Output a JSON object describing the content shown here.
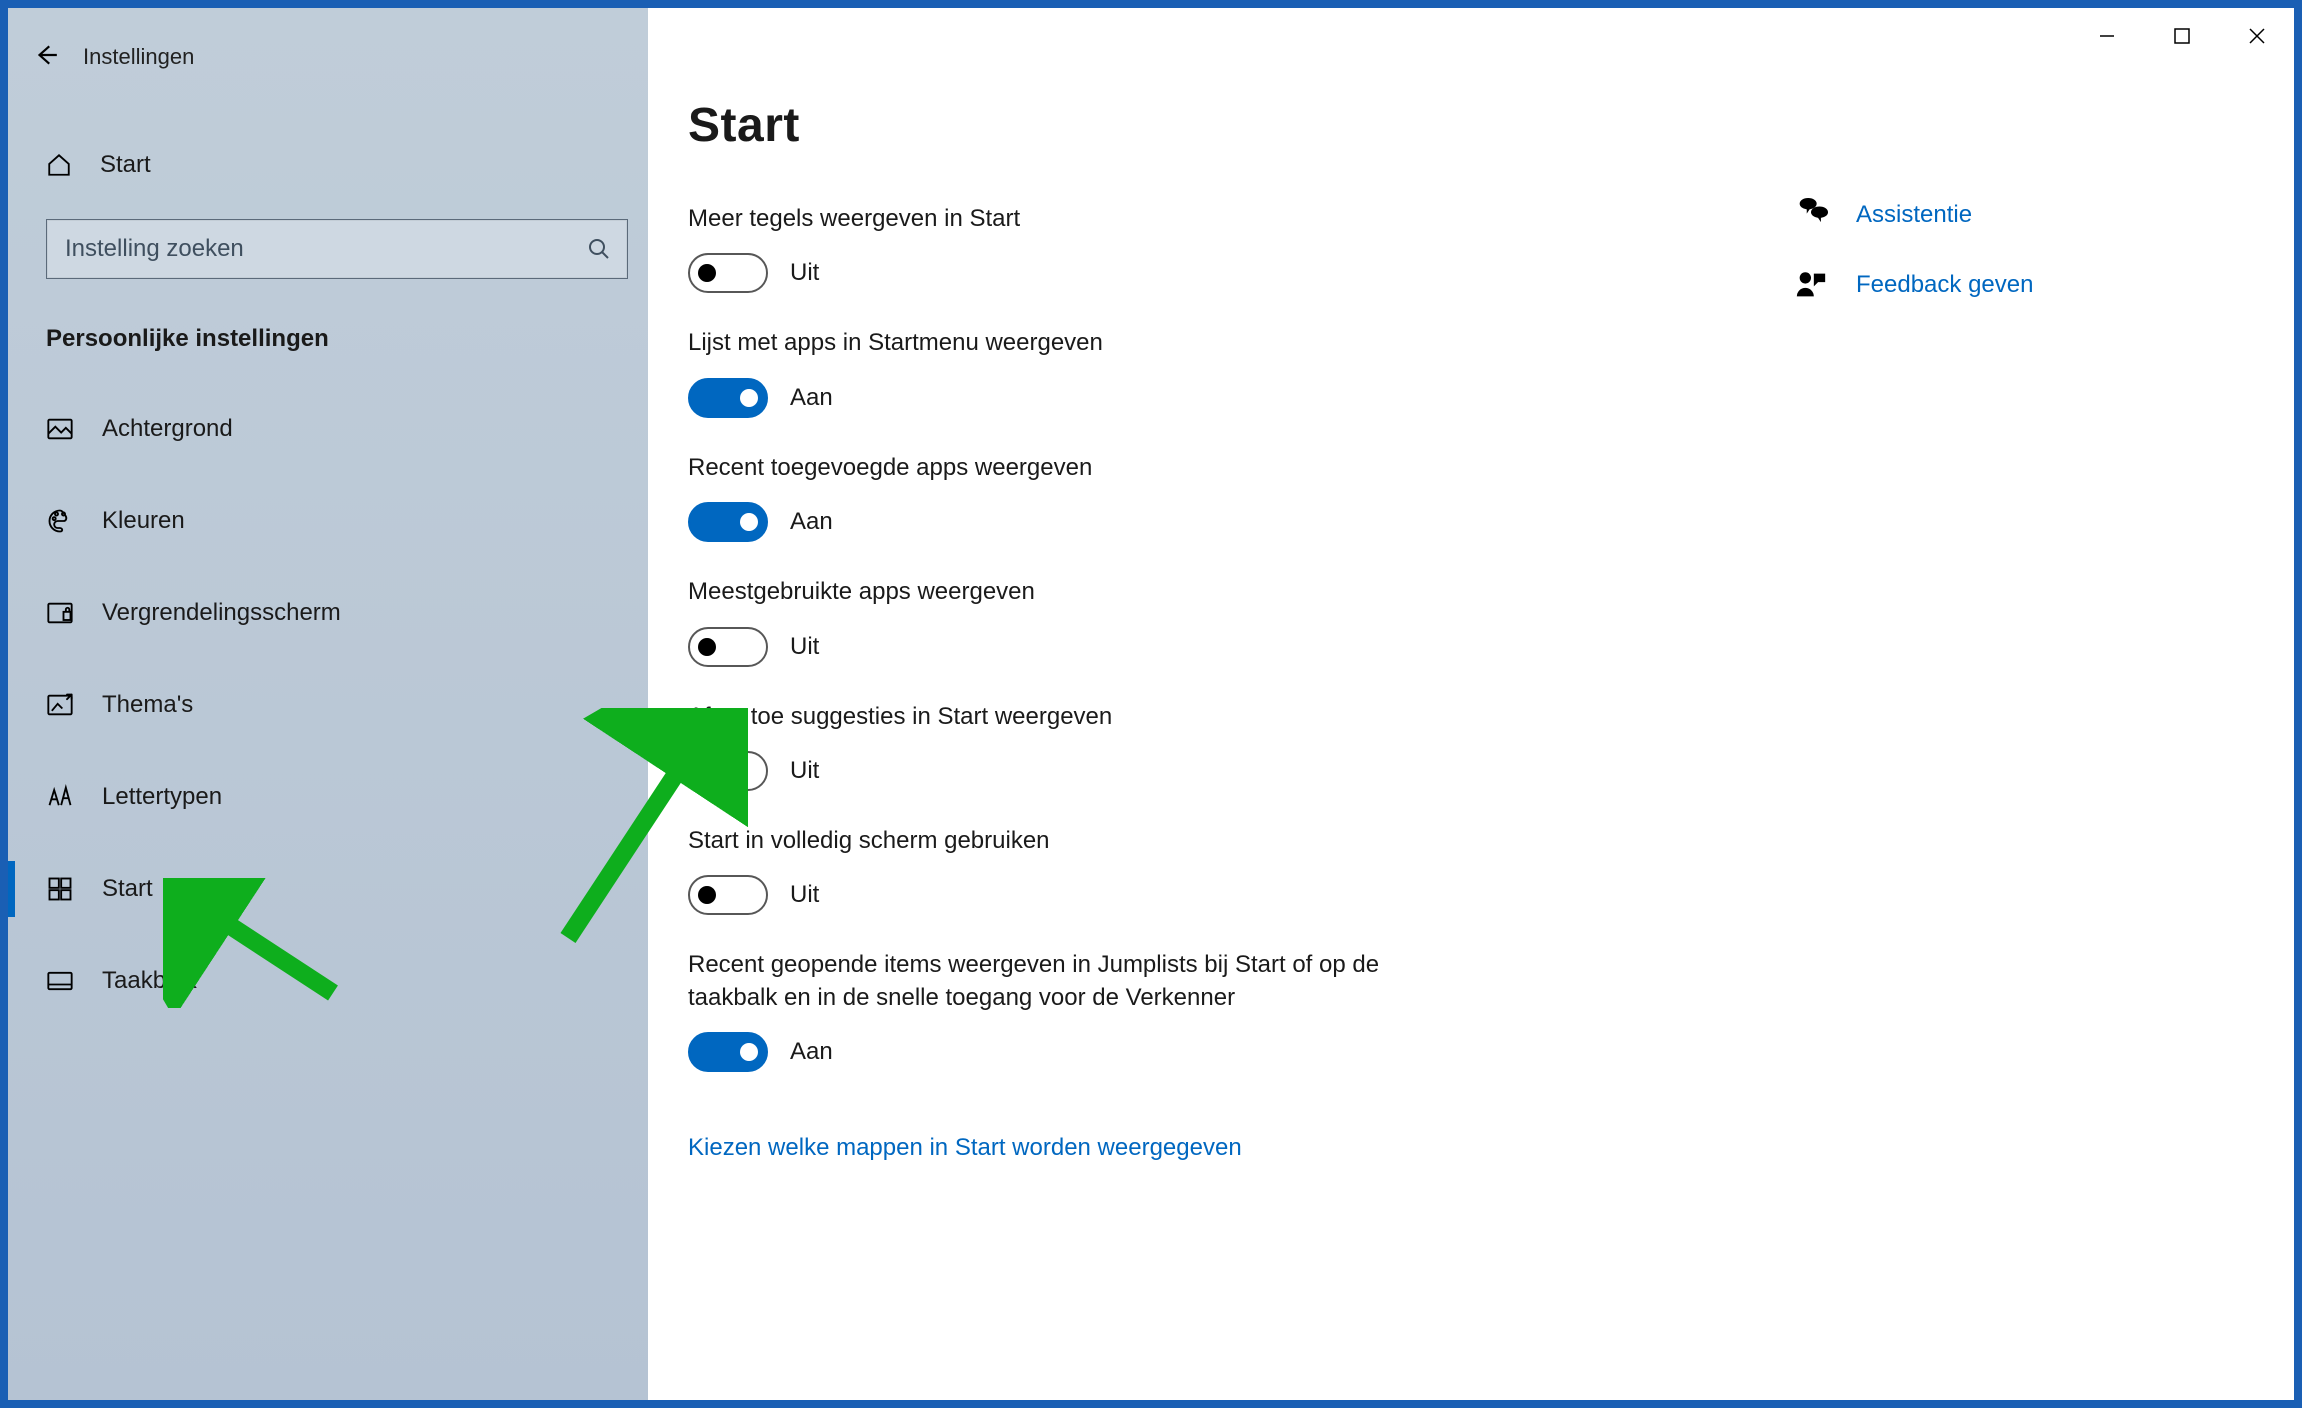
{
  "header": {
    "app_title": "Instellingen"
  },
  "sidebar": {
    "home": "Start",
    "search_placeholder": "Instelling zoeken",
    "section_title": "Persoonlijke instellingen",
    "items": [
      {
        "label": "Achtergrond"
      },
      {
        "label": "Kleuren"
      },
      {
        "label": "Vergrendelingsscherm"
      },
      {
        "label": "Thema's"
      },
      {
        "label": "Lettertypen"
      },
      {
        "label": "Start"
      },
      {
        "label": "Taakbalk"
      }
    ]
  },
  "main": {
    "page_title": "Start",
    "state_on": "Aan",
    "state_off": "Uit",
    "settings": [
      {
        "label": "Meer tegels weergeven in Start",
        "on": false
      },
      {
        "label": "Lijst met apps in Startmenu weergeven",
        "on": true
      },
      {
        "label": "Recent toegevoegde apps weergeven",
        "on": true
      },
      {
        "label": "Meestgebruikte apps weergeven",
        "on": false
      },
      {
        "label": "Af en toe suggesties in Start weergeven",
        "on": false
      },
      {
        "label": "Start in volledig scherm gebruiken",
        "on": false
      },
      {
        "label": "Recent geopende items weergeven in Jumplists bij Start of op de taakbalk en in de snelle toegang voor de Verkenner",
        "on": true
      }
    ],
    "footer_link": "Kiezen welke mappen in Start worden weergegeven"
  },
  "right": {
    "help": "Assistentie",
    "feedback": "Feedback geven"
  },
  "colors": {
    "accent": "#0067c0",
    "arrow": "#0eae1d"
  }
}
